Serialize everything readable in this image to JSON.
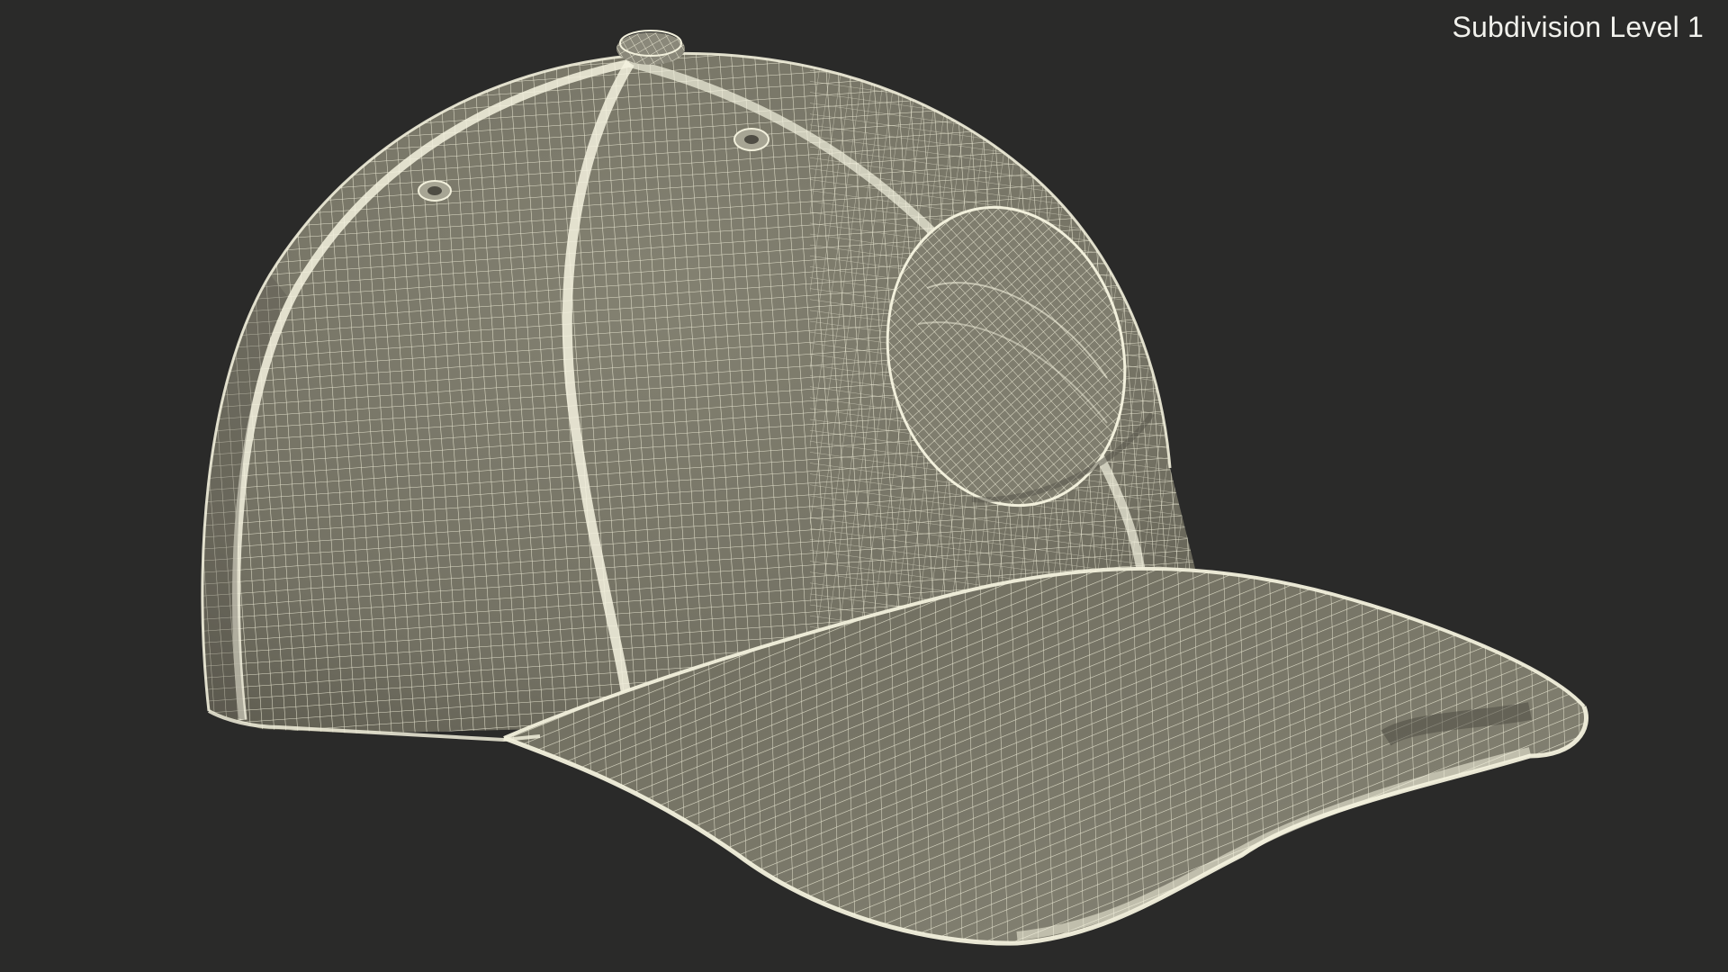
{
  "viewport": {
    "subdivision_label": "Subdivision Level 1"
  },
  "scene": {
    "background_color": "#2a2a29",
    "surface_color": "#7a7868",
    "wire_color": "#eeecd6",
    "shadow_color": "#5f5d50",
    "object": "baseball-cap-wireframe"
  }
}
